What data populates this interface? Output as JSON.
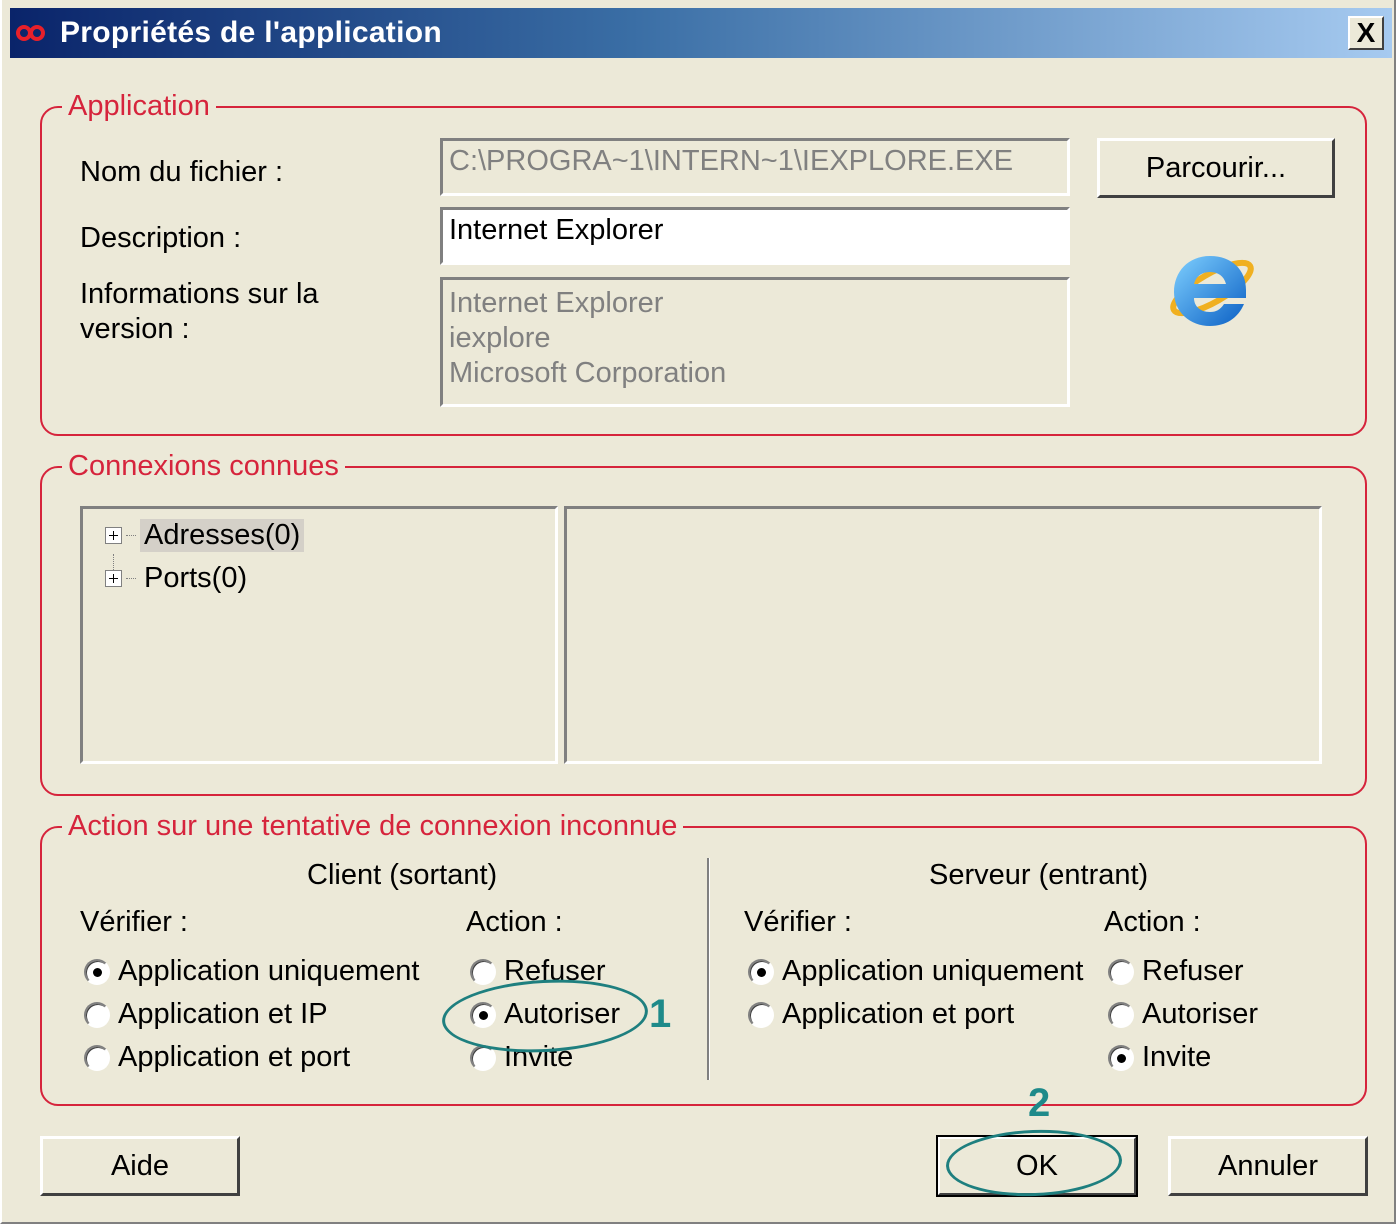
{
  "window": {
    "title": "Propriétés de l'application",
    "close_label": "X"
  },
  "application_group": {
    "title": "Application",
    "filename_label": "Nom du fichier :",
    "filename_value": "C:\\PROGRA~1\\INTERN~1\\IEXPLORE.EXE",
    "browse_label": "Parcourir...",
    "description_label": "Description :",
    "description_value": "Internet Explorer",
    "version_label_line1": "Informations sur la",
    "version_label_line2": "version :",
    "version_lines": [
      "Internet Explorer",
      "iexplore",
      "Microsoft Corporation"
    ],
    "app_icon": "internet-explorer-icon"
  },
  "connections_group": {
    "title": "Connexions connues",
    "tree": [
      {
        "label": "Adresses(0)",
        "selected": true
      },
      {
        "label": "Ports(0)",
        "selected": false
      }
    ]
  },
  "action_group": {
    "title": "Action sur une tentative de connexion inconnue",
    "client": {
      "heading": "Client (sortant)",
      "verify_label": "Vérifier :",
      "verify_options": [
        {
          "label": "Application uniquement",
          "checked": true
        },
        {
          "label": "Application et IP",
          "checked": false
        },
        {
          "label": "Application et port",
          "checked": false
        }
      ],
      "action_label": "Action :",
      "action_options": [
        {
          "label": "Refuser",
          "checked": false
        },
        {
          "label": "Autoriser",
          "checked": true
        },
        {
          "label": "Invite",
          "checked": false
        }
      ]
    },
    "server": {
      "heading": "Serveur (entrant)",
      "verify_label": "Vérifier :",
      "verify_options": [
        {
          "label": "Application uniquement",
          "checked": true
        },
        {
          "label": "Application et port",
          "checked": false
        }
      ],
      "action_label": "Action :",
      "action_options": [
        {
          "label": "Refuser",
          "checked": false
        },
        {
          "label": "Autoriser",
          "checked": false
        },
        {
          "label": "Invite",
          "checked": true
        }
      ]
    }
  },
  "buttons": {
    "help": "Aide",
    "ok": "OK",
    "cancel": "Annuler"
  },
  "annotations": {
    "step1": "1",
    "step2": "2",
    "color": "#1e7f7f"
  },
  "colors": {
    "group_border": "#d6243c",
    "title_start": "#0a246a",
    "title_end": "#a6caf0"
  }
}
